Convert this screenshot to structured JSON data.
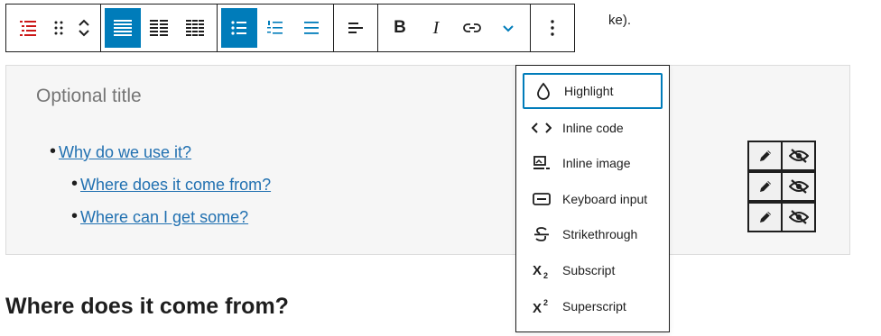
{
  "background_text": "ke).",
  "toolbar": {
    "block_type_icon": "table-of-contents-icon",
    "drag_handle_icon": "drag-handle-icon",
    "move_icon": "move-up-down-icon",
    "groups": [
      {
        "name": "list-style",
        "items": [
          "list-style-full-icon",
          "list-style-two-col-icon",
          "list-style-three-col-icon"
        ]
      },
      {
        "name": "list-type",
        "items": [
          "unordered-list-icon",
          "ordered-list-icon",
          "plain-list-icon"
        ]
      },
      {
        "name": "alignment",
        "items": [
          "align-left-icon"
        ]
      },
      {
        "name": "format",
        "items": [
          "bold-icon",
          "italic-icon",
          "link-icon",
          "more-formats-icon"
        ]
      },
      {
        "name": "options",
        "items": [
          "more-options-icon"
        ]
      }
    ],
    "bold_label": "B",
    "italic_label": "I",
    "accent_color": "#007cba"
  },
  "block": {
    "title": "Optional title",
    "items": [
      {
        "label": "Why do we use it?",
        "level": 1
      },
      {
        "label": "Where does it come from?",
        "level": 2
      },
      {
        "label": "Where can I get some?",
        "level": 2
      }
    ],
    "row_actions": [
      {
        "edit_icon": "pencil-icon",
        "visibility_icon": "eye-slash-icon"
      },
      {
        "edit_icon": "pencil-icon",
        "visibility_icon": "eye-slash-icon"
      },
      {
        "edit_icon": "pencil-icon",
        "visibility_icon": "eye-slash-icon"
      }
    ]
  },
  "heading": "Where does it come from?",
  "dropdown": {
    "items": [
      {
        "label": "Highlight",
        "icon": "droplet-icon",
        "focused": true
      },
      {
        "label": "Inline code",
        "icon": "code-icon"
      },
      {
        "label": "Inline image",
        "icon": "image-icon"
      },
      {
        "label": "Keyboard input",
        "icon": "keyboard-icon"
      },
      {
        "label": "Strikethrough",
        "icon": "strikethrough-icon"
      },
      {
        "label": "Subscript",
        "icon": "subscript-icon"
      },
      {
        "label": "Superscript",
        "icon": "superscript-icon"
      }
    ]
  }
}
